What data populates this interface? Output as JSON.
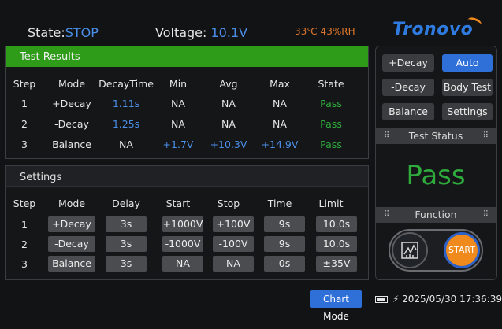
{
  "header": {
    "state_label": "State:",
    "state_value": "STOP",
    "voltage_label": "Voltage:",
    "voltage_value": "10.1V",
    "environment": "33℃  43%RH",
    "brand": "Tronovo"
  },
  "results": {
    "title": "Test Results",
    "columns": [
      "Step",
      "Mode",
      "DecayTime",
      "Min",
      "Avg",
      "Max",
      "State"
    ],
    "rows": [
      {
        "step": "1",
        "mode": "+Decay",
        "decay_time": "1.11s",
        "min": "NA",
        "avg": "NA",
        "max": "NA",
        "state": "Pass"
      },
      {
        "step": "2",
        "mode": "-Decay",
        "decay_time": "1.25s",
        "min": "NA",
        "avg": "NA",
        "max": "NA",
        "state": "Pass"
      },
      {
        "step": "3",
        "mode": "Balance",
        "decay_time": "NA",
        "min": "+1.7V",
        "avg": "+10.3V",
        "max": "+14.9V",
        "state": "Pass"
      }
    ]
  },
  "settings": {
    "title": "Settings",
    "columns": [
      "Step",
      "Mode",
      "Delay",
      "Start",
      "Stop",
      "Time",
      "Limit"
    ],
    "rows": [
      {
        "step": "1",
        "mode": "+Decay",
        "delay": "3s",
        "start": "+1000V",
        "stop": "+100V",
        "time": "9s",
        "limit": "10.0s"
      },
      {
        "step": "2",
        "mode": "-Decay",
        "delay": "3s",
        "start": "-1000V",
        "stop": "-100V",
        "time": "9s",
        "limit": "10.0s"
      },
      {
        "step": "3",
        "mode": "Balance",
        "delay": "3s",
        "start": "NA",
        "stop": "NA",
        "time": "0s",
        "limit": "±35V"
      }
    ]
  },
  "side_panel": {
    "buttons": {
      "plus_decay": "+Decay",
      "auto": "Auto",
      "minus_decay": "-Decay",
      "body_test": "Body Test",
      "balance": "Balance",
      "settings": "Settings"
    },
    "test_status_title": "Test Status",
    "test_status_value": "Pass",
    "function_title": "Function",
    "start_label": "START"
  },
  "footer": {
    "chart_mode": "Chart Mode",
    "datetime": "2025/05/30 17:36:39"
  },
  "colors": {
    "accent_blue": "#2f6fd8",
    "pass_green": "#2faa3c",
    "header_green": "#2e9c18",
    "orange": "#f08a1c"
  },
  "icons": [
    "battery-icon",
    "charging-plug-icon",
    "grip-icon",
    "stop-hand-icon"
  ]
}
